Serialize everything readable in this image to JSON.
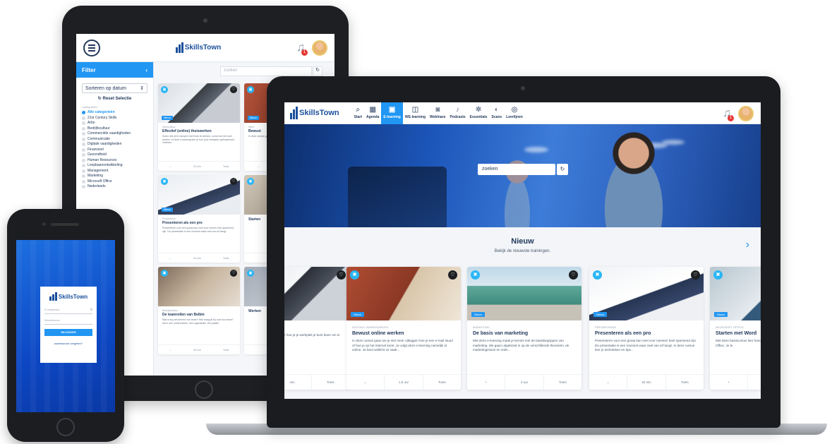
{
  "brand": "SkillsTown",
  "tablet": {
    "filter_label": "Filter",
    "sort_label": "Sorteren op datum",
    "reset_label": "Reset Selectie",
    "categories_header": "Categorieën",
    "categories": [
      "Alle categorieën",
      "21st Century Skills",
      "Arbo",
      "Bedrijfscultuur",
      "Commerciële vaardigheden",
      "Communicatie",
      "Digitale vaardigheden",
      "Financieel",
      "Gezondheid",
      "Human Resources",
      "Loopbaanontwikkeling",
      "Management",
      "Marketing",
      "Microsoft Office",
      "Nederlands"
    ],
    "search_placeholder": "zoeken",
    "cards": [
      {
        "tag": "Nieuw",
        "category": "Werkcultuur",
        "title": "Effectief (online) thuiswerken",
        "text": "Soms heb je te kampen met thuis te werken, soms kort het snel anders. In deze e-learning leer je hoe je je werkplek optimaal kunt inrichten.",
        "f1": "↔",
        "f2": "30 min",
        "f3": "Toets"
      },
      {
        "tag": "Nieuw",
        "category": "Werk",
        "title": "Bewust",
        "text": "In deze cursus gaan we je niet uitleggen hoe je een e-mail stuurt.",
        "f1": "↔",
        "f2": "",
        "f3": ""
      },
      {
        "tag": "Nieuw",
        "category": "Presenteren",
        "title": "Presenteren als een pro",
        "text": "Presenteren voor een groep kan veel voor menen heel spannend zijn. De presentatie is een moment waar veel van af hangt.",
        "f1": "↔",
        "f2": "40 min",
        "f3": "Toets"
      },
      {
        "tag": "",
        "category": "",
        "title": "Starten",
        "text": "",
        "f1": "",
        "f2": "",
        "f3": ""
      },
      {
        "tag": "",
        "category": "Bedrijfscultuur",
        "title": "De teamrollen van Belbin",
        "text": "Wat is erg net kernen hoe team? Heb maag ik bij ouw hun team? Na in ons onderzoeken, een organisatie, één plaats.",
        "f1": "↔",
        "f2": "45 min",
        "f3": "Toets"
      },
      {
        "tag": "",
        "category": "",
        "title": "Werken",
        "text": "",
        "f1": "",
        "f2": "",
        "f3": ""
      }
    ]
  },
  "phone": {
    "email_placeholder": "E-mailadres",
    "password_placeholder": "Wachtwoord",
    "login_button": "INLOGGEN",
    "forgot_link": "wachtwoord vergeten?"
  },
  "laptop": {
    "nav": [
      {
        "label": "Start",
        "icon": "⌕"
      },
      {
        "label": "Agenda",
        "icon": "▦"
      },
      {
        "label": "E-learning",
        "icon": "▣"
      },
      {
        "label": "WE-learning",
        "icon": "◫"
      },
      {
        "label": "Webinars",
        "icon": "◙"
      },
      {
        "label": "Podcasts",
        "icon": "♪"
      },
      {
        "label": "Essentials",
        "icon": "✲"
      },
      {
        "label": "Scans",
        "icon": "◐"
      },
      {
        "label": "Leerlijnen",
        "icon": "◎"
      }
    ],
    "search_placeholder": "zoeken",
    "section_title": "Nieuw",
    "section_subtitle": "Bekijk de nieuwste trainingen.",
    "cards": [
      {
        "tag": "",
        "category": "",
        "title": "te werken",
        "text": "te werken, soms kan het leer je hoe je je werkplek je kunt doen om in contac...",
        "f1": "",
        "f2": "min",
        "f3": "Toets"
      },
      {
        "tag": "Nieuw",
        "category": "Digitale vaardigheden",
        "title": "Bewust online werken",
        "text": "In deze cursus gaan we je niet meer uitleggen hoe je een e-mail stuurt of hoe je op het internet komt. Je volgt deze e-learning namelijk al online. Je bent wellicht ze vaak...",
        "f1": "↔",
        "f2": "1,5 uur",
        "f3": "Toets"
      },
      {
        "tag": "Nieuw",
        "category": "Marketing",
        "title": "De basis van marketing",
        "text": "Met deze e-learning maak je kennis met de basisbegrippen van marketing. We gaan uitgebreid in op de verschillende theorieën, de marketingmixes en onlin...",
        "f1": "+",
        "f2": "3 uur",
        "f3": "Toets"
      },
      {
        "tag": "Nieuw",
        "category": "Presenteren",
        "title": "Presenteren als een pro",
        "text": "Presenteren voor een groep kan veel voor mensen heel spannend zijn. De presentatie is een moment waar veel van af hangt. In deze cursus leer je technieken en tips...",
        "f1": "↔",
        "f2": "40 min",
        "f3": "Toets"
      },
      {
        "tag": "Nieuw",
        "category": "Microsoft Office",
        "title": "Starten met Word",
        "text": "Met deze basiscursus leer handelingen in het teksto van Microsoft Office. Je le",
        "f1": "+",
        "f2": "",
        "f3": ""
      }
    ]
  },
  "colors": {
    "accent": "#2196f3",
    "navy": "#23395b",
    "badge": "#e53935"
  }
}
